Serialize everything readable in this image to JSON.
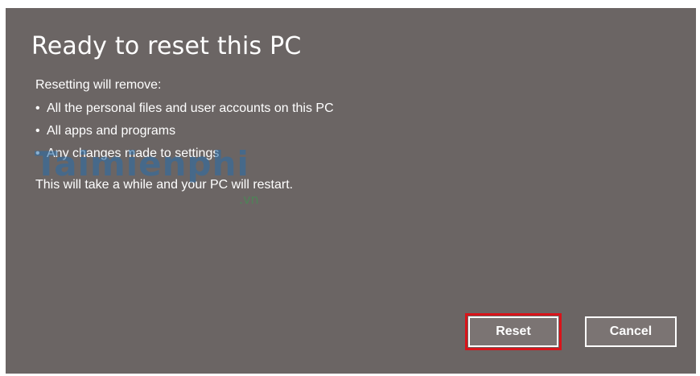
{
  "dialog": {
    "title": "Ready to reset this PC",
    "intro": "Resetting will remove:",
    "items": [
      "All the personal files and user accounts on this PC",
      "All apps and programs",
      "Any changes made to settings"
    ],
    "outro": "This will take a while and your PC will restart.",
    "bullet_char": "•"
  },
  "buttons": {
    "reset_label": "Reset",
    "cancel_label": "Cancel",
    "highlight_color": "#d8141a"
  },
  "watermark": {
    "main": "Taimienphi",
    "sub": ".vn"
  },
  "colors": {
    "dialog_background": "#6b6564",
    "text": "#ffffff"
  }
}
